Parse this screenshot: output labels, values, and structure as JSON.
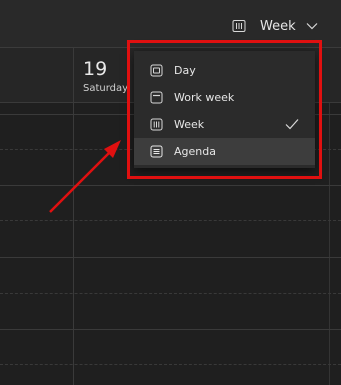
{
  "toolbar": {
    "view_switch_label": "Week",
    "view_icon": "week-grid-icon",
    "dropdown_icon": "chevron-down-icon"
  },
  "day_header": {
    "day_number": "19",
    "day_name": "Saturday"
  },
  "view_menu": {
    "items": [
      {
        "label": "Day",
        "icon": "day-view-icon",
        "checked": false,
        "highlighted": false
      },
      {
        "label": "Work week",
        "icon": "work-week-view-icon",
        "checked": false,
        "highlighted": false
      },
      {
        "label": "Week",
        "icon": "week-view-icon",
        "checked": true,
        "highlighted": false
      },
      {
        "label": "Agenda",
        "icon": "agenda-view-icon",
        "checked": false,
        "highlighted": true
      }
    ],
    "check_icon": "checkmark-icon"
  },
  "annotation": {
    "color": "#e01010"
  },
  "colors": {
    "background": "#1f1f1f",
    "toolbar": "#292929",
    "menu": "#2b2b2b",
    "menu_highlight": "#3d3d3d",
    "text": "#e6e6e6"
  }
}
